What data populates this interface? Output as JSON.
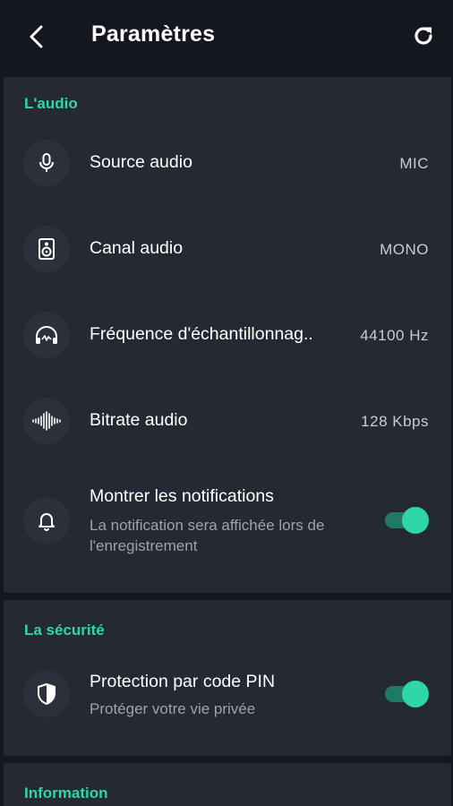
{
  "header": {
    "title": "Paramètres",
    "back_icon": "chevron-left-icon",
    "refresh_icon": "refresh-icon"
  },
  "sections": {
    "audio": {
      "title": "L'audio",
      "items": [
        {
          "label": "Source audio",
          "value": "MIC",
          "icon": "microphone-icon"
        },
        {
          "label": "Canal audio",
          "value": "MONO",
          "icon": "speaker-icon"
        },
        {
          "label": "Fréquence d'échantillonnag..",
          "value": "44100 Hz",
          "icon": "headphones-icon"
        },
        {
          "label": "Bitrate audio",
          "value": "128 Kbps",
          "icon": "waveform-icon"
        }
      ],
      "notifications": {
        "label": "Montrer les notifications",
        "sub_line1": "La notification sera affichée lors de",
        "sub_line2": "l'enregistrement",
        "enabled": true,
        "icon": "bell-icon"
      }
    },
    "security": {
      "title": "La sécurité",
      "pin": {
        "label": "Protection par code PIN",
        "sub": "Protéger votre vie privée",
        "enabled": true,
        "icon": "shield-icon"
      }
    },
    "info": {
      "title": "Information"
    }
  },
  "colors": {
    "background": "#15171e",
    "card": "#252934",
    "accent": "#2fd6a6",
    "toggle_track": "#1f7a63"
  }
}
